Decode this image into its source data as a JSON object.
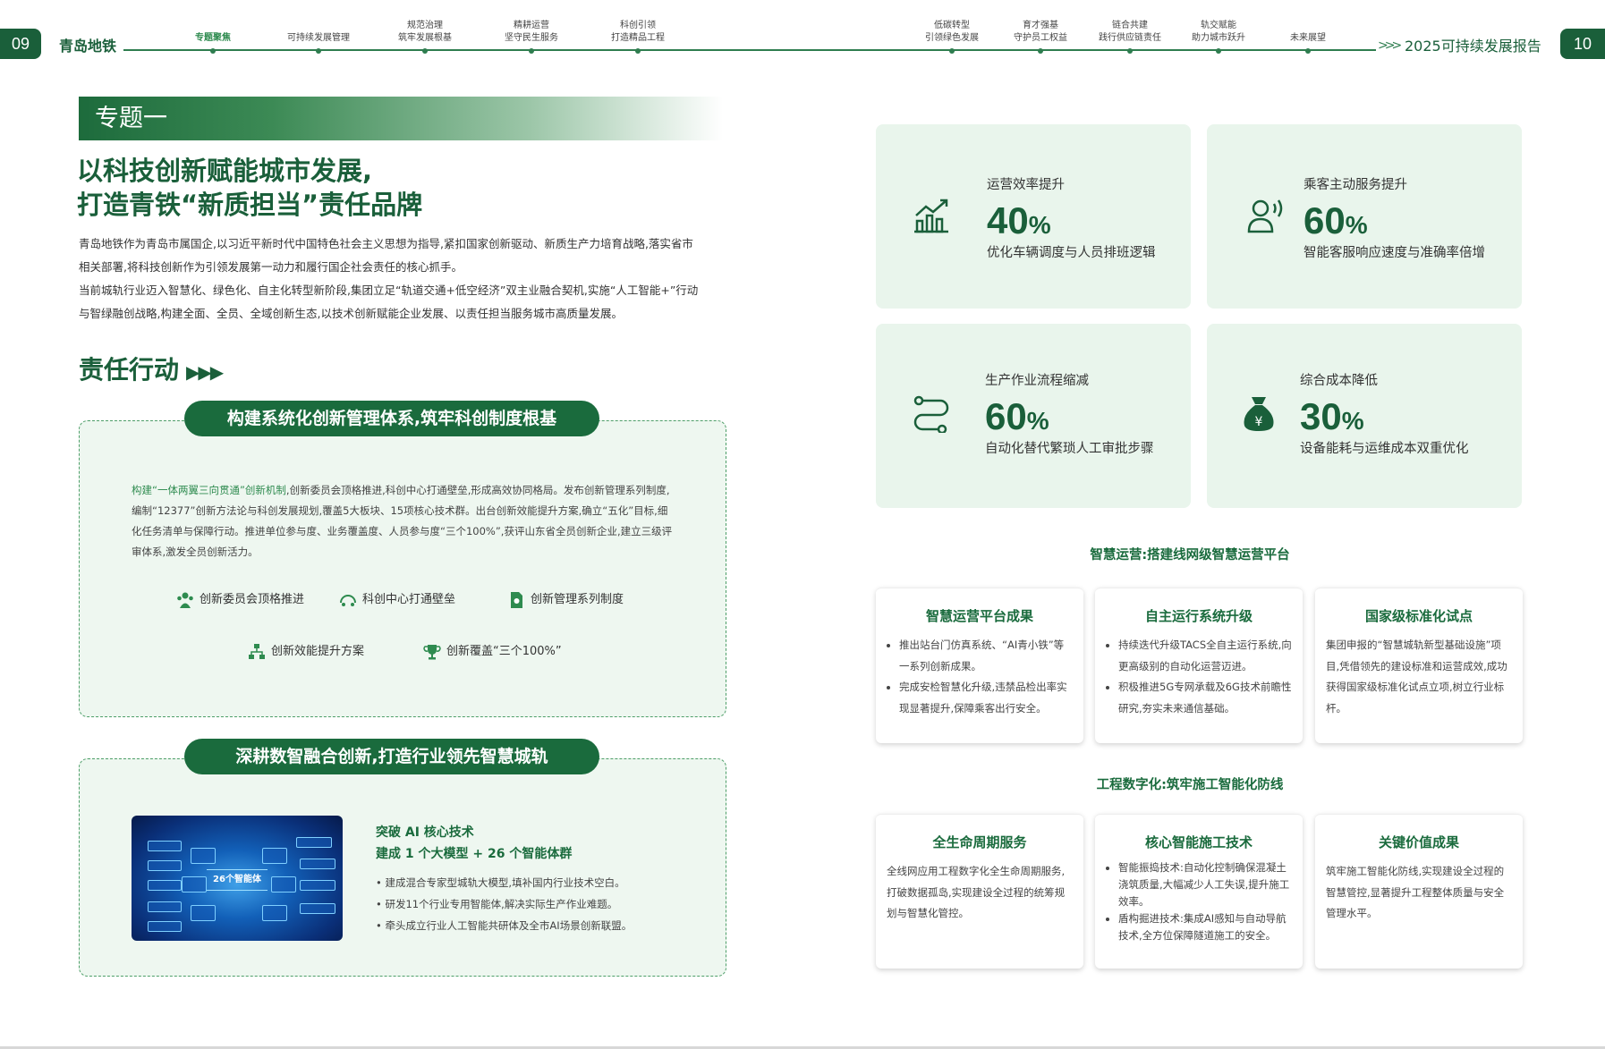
{
  "header": {
    "page_left": "09",
    "page_right": "10",
    "brand_left": "青岛地铁",
    "brand_right": "2025可持续发展报告",
    "nav": [
      {
        "l1": "",
        "l2": "专题聚焦",
        "active": true
      },
      {
        "l1": "",
        "l2": "可持续发展管理",
        "active": false
      },
      {
        "l1": "规范治理",
        "l2": "筑牢发展根基",
        "active": false
      },
      {
        "l1": "精耕运营",
        "l2": "坚守民生服务",
        "active": false
      },
      {
        "l1": "科创引领",
        "l2": "打造精品工程",
        "active": false
      },
      {
        "l1": "低碳转型",
        "l2": "引领绿色发展",
        "active": false
      },
      {
        "l1": "育才强基",
        "l2": "守护员工权益",
        "active": false
      },
      {
        "l1": "链合共建",
        "l2": "践行供应链责任",
        "active": false
      },
      {
        "l1": "轨交赋能",
        "l2": "助力城市跃升",
        "active": false
      },
      {
        "l1": "",
        "l2": "未来展望",
        "active": false
      }
    ]
  },
  "left": {
    "topic": "专题一",
    "title_line1": "以科技创新赋能城市发展,",
    "title_line2": "打造青铁“新质担当”责任品牌",
    "intro": [
      "青岛地铁作为青岛市属国企,以习近平新时代中国特色社会主义思想为指导,紧扣国家创新驱动、新质生产力培育战略,落实省市",
      "相关部署,将科技创新作为引领发展第一动力和履行国企社会责任的核心抓手。",
      "当前城轨行业迈入智慧化、绿色化、自主化转型新阶段,集团立足“轨道交通+低空经济”双主业融合契机,实施“人工智能+”行动",
      "与智绿融创战略,构建全面、全员、全域创新生态,以技术创新赋能企业发展、以责任担当服务城市高质量发展。"
    ],
    "action_title": "责任行动",
    "panel1": {
      "pill": "构建系统化创新管理体系,筑牢科创制度根基",
      "text_highlight": "构建“一体两翼三向贯通”创新机制",
      "text_rest": ",创新委员会顶格推进,科创中心打通壁垒,形成高效协同格局。发布创新管理系列制度,编制“12377”创新方法论与科创发展规划,覆盖5大板块、15项核心技术群。出台创新效能提升方案,确立“五化”目标,细化任务清单与保障行动。推进单位参与度、业务覆盖度、人员参与度“三个100%”,获评山东省全员创新企业,建立三级评审体系,激发全员创新活力。",
      "features": [
        {
          "icon": "committee-icon",
          "label": "创新委员会顶格推进"
        },
        {
          "icon": "tech-center-icon",
          "label": "科创中心打通壁垒"
        },
        {
          "icon": "document-icon",
          "label": "创新管理系列制度"
        },
        {
          "icon": "org-chart-icon",
          "label": "创新效能提升方案"
        },
        {
          "icon": "trophy-icon",
          "label": "创新覆盖“三个100%”"
        }
      ]
    },
    "panel2": {
      "pill": "深耕数智融合创新,打造行业领先智慧城轨",
      "heading1": "突破 AI 核心技术",
      "heading2": "建成 1 个大模型 + 26 个智能体群",
      "bullets": [
        "• 建成混合专家型城轨大模型,填补国内行业技术空白。",
        "• 研发11个行业专用智能体,解决实际生产作业难题。",
        "• 牵头成立行业人工智能共研体及全市AI场景创新联盟。"
      ],
      "image_center": "26个智能体"
    }
  },
  "right": {
    "stats": [
      {
        "icon": "growth-chart-icon",
        "label": "运营效率提升",
        "value": "40",
        "unit": "%",
        "desc": "优化车辆调度与人员排班逻辑"
      },
      {
        "icon": "voice-service-icon",
        "label": "乘客主动服务提升",
        "value": "60",
        "unit": "%",
        "desc": "智能客服响应速度与准确率倍增"
      },
      {
        "icon": "process-flow-icon",
        "label": "生产作业流程缩减",
        "value": "60",
        "unit": "%",
        "desc": "自动化替代繁琐人工审批步骤"
      },
      {
        "icon": "money-bag-icon",
        "label": "综合成本降低",
        "value": "30",
        "unit": "%",
        "desc": "设备能耗与运维成本双重优化"
      }
    ],
    "section1_title": "智慧运营:搭建线网级智慧运营平台",
    "section1_cards": [
      {
        "title": "智慧运营平台成果",
        "items": [
          "推出站台门仿真系统、“AI青小铁”等一系列创新成果。",
          "完成安检智慧化升级,违禁品检出率实现显著提升,保障乘客出行安全。"
        ]
      },
      {
        "title": "自主运行系统升级",
        "items": [
          "持续迭代升级TACS全自主运行系统,向更高级别的自动化运营迈进。",
          "积极推进5G专网承载及6G技术前瞻性研究,夯实未来通信基础。"
        ]
      },
      {
        "title": "国家级标准化试点",
        "text": "集团申报的“智慧城轨新型基础设施”项目,凭借领先的建设标准和运营成效,成功获得国家级标准化试点立项,树立行业标杆。"
      }
    ],
    "section2_title": "工程数字化:筑牢施工智能化防线",
    "section2_cards": [
      {
        "title": "全生命周期服务",
        "text": "全线网应用工程数字化全生命周期服务,打破数据孤岛,实现建设全过程的统筹规划与智慧化管控。"
      },
      {
        "title": "核心智能施工技术",
        "items": [
          "智能振捣技术:自动化控制确保混凝土浇筑质量,大幅减少人工失误,提升施工效率。",
          "盾构掘进技术:集成AI感知与自动导航技术,全方位保障隧道施工的安全。"
        ]
      },
      {
        "title": "关键价值成果",
        "text": "筑牢施工智能化防线,实现建设全过程的智慧管控,显著提升工程整体质量与安全管理水平。"
      }
    ]
  }
}
